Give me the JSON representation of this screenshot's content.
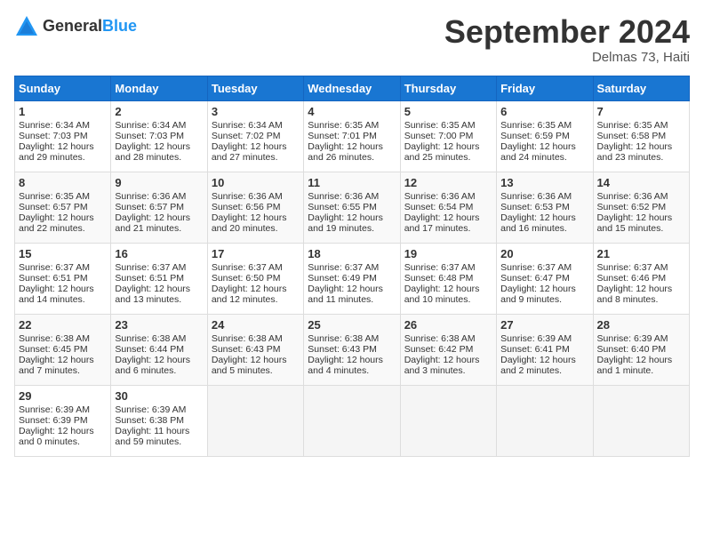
{
  "header": {
    "logo_general": "General",
    "logo_blue": "Blue",
    "month_title": "September 2024",
    "location": "Delmas 73, Haiti"
  },
  "days_of_week": [
    "Sunday",
    "Monday",
    "Tuesday",
    "Wednesday",
    "Thursday",
    "Friday",
    "Saturday"
  ],
  "weeks": [
    [
      {
        "day": "1",
        "sunrise": "6:34 AM",
        "sunset": "7:03 PM",
        "daylight": "Daylight: 12 hours and 29 minutes."
      },
      {
        "day": "2",
        "sunrise": "6:34 AM",
        "sunset": "7:03 PM",
        "daylight": "Daylight: 12 hours and 28 minutes."
      },
      {
        "day": "3",
        "sunrise": "6:34 AM",
        "sunset": "7:02 PM",
        "daylight": "Daylight: 12 hours and 27 minutes."
      },
      {
        "day": "4",
        "sunrise": "6:35 AM",
        "sunset": "7:01 PM",
        "daylight": "Daylight: 12 hours and 26 minutes."
      },
      {
        "day": "5",
        "sunrise": "6:35 AM",
        "sunset": "7:00 PM",
        "daylight": "Daylight: 12 hours and 25 minutes."
      },
      {
        "day": "6",
        "sunrise": "6:35 AM",
        "sunset": "6:59 PM",
        "daylight": "Daylight: 12 hours and 24 minutes."
      },
      {
        "day": "7",
        "sunrise": "6:35 AM",
        "sunset": "6:58 PM",
        "daylight": "Daylight: 12 hours and 23 minutes."
      }
    ],
    [
      {
        "day": "8",
        "sunrise": "6:35 AM",
        "sunset": "6:57 PM",
        "daylight": "Daylight: 12 hours and 22 minutes."
      },
      {
        "day": "9",
        "sunrise": "6:36 AM",
        "sunset": "6:57 PM",
        "daylight": "Daylight: 12 hours and 21 minutes."
      },
      {
        "day": "10",
        "sunrise": "6:36 AM",
        "sunset": "6:56 PM",
        "daylight": "Daylight: 12 hours and 20 minutes."
      },
      {
        "day": "11",
        "sunrise": "6:36 AM",
        "sunset": "6:55 PM",
        "daylight": "Daylight: 12 hours and 19 minutes."
      },
      {
        "day": "12",
        "sunrise": "6:36 AM",
        "sunset": "6:54 PM",
        "daylight": "Daylight: 12 hours and 17 minutes."
      },
      {
        "day": "13",
        "sunrise": "6:36 AM",
        "sunset": "6:53 PM",
        "daylight": "Daylight: 12 hours and 16 minutes."
      },
      {
        "day": "14",
        "sunrise": "6:36 AM",
        "sunset": "6:52 PM",
        "daylight": "Daylight: 12 hours and 15 minutes."
      }
    ],
    [
      {
        "day": "15",
        "sunrise": "6:37 AM",
        "sunset": "6:51 PM",
        "daylight": "Daylight: 12 hours and 14 minutes."
      },
      {
        "day": "16",
        "sunrise": "6:37 AM",
        "sunset": "6:51 PM",
        "daylight": "Daylight: 12 hours and 13 minutes."
      },
      {
        "day": "17",
        "sunrise": "6:37 AM",
        "sunset": "6:50 PM",
        "daylight": "Daylight: 12 hours and 12 minutes."
      },
      {
        "day": "18",
        "sunrise": "6:37 AM",
        "sunset": "6:49 PM",
        "daylight": "Daylight: 12 hours and 11 minutes."
      },
      {
        "day": "19",
        "sunrise": "6:37 AM",
        "sunset": "6:48 PM",
        "daylight": "Daylight: 12 hours and 10 minutes."
      },
      {
        "day": "20",
        "sunrise": "6:37 AM",
        "sunset": "6:47 PM",
        "daylight": "Daylight: 12 hours and 9 minutes."
      },
      {
        "day": "21",
        "sunrise": "6:37 AM",
        "sunset": "6:46 PM",
        "daylight": "Daylight: 12 hours and 8 minutes."
      }
    ],
    [
      {
        "day": "22",
        "sunrise": "6:38 AM",
        "sunset": "6:45 PM",
        "daylight": "Daylight: 12 hours and 7 minutes."
      },
      {
        "day": "23",
        "sunrise": "6:38 AM",
        "sunset": "6:44 PM",
        "daylight": "Daylight: 12 hours and 6 minutes."
      },
      {
        "day": "24",
        "sunrise": "6:38 AM",
        "sunset": "6:43 PM",
        "daylight": "Daylight: 12 hours and 5 minutes."
      },
      {
        "day": "25",
        "sunrise": "6:38 AM",
        "sunset": "6:43 PM",
        "daylight": "Daylight: 12 hours and 4 minutes."
      },
      {
        "day": "26",
        "sunrise": "6:38 AM",
        "sunset": "6:42 PM",
        "daylight": "Daylight: 12 hours and 3 minutes."
      },
      {
        "day": "27",
        "sunrise": "6:39 AM",
        "sunset": "6:41 PM",
        "daylight": "Daylight: 12 hours and 2 minutes."
      },
      {
        "day": "28",
        "sunrise": "6:39 AM",
        "sunset": "6:40 PM",
        "daylight": "Daylight: 12 hours and 1 minute."
      }
    ],
    [
      {
        "day": "29",
        "sunrise": "6:39 AM",
        "sunset": "6:39 PM",
        "daylight": "Daylight: 12 hours and 0 minutes."
      },
      {
        "day": "30",
        "sunrise": "6:39 AM",
        "sunset": "6:38 PM",
        "daylight": "Daylight: 11 hours and 59 minutes."
      },
      null,
      null,
      null,
      null,
      null
    ]
  ]
}
